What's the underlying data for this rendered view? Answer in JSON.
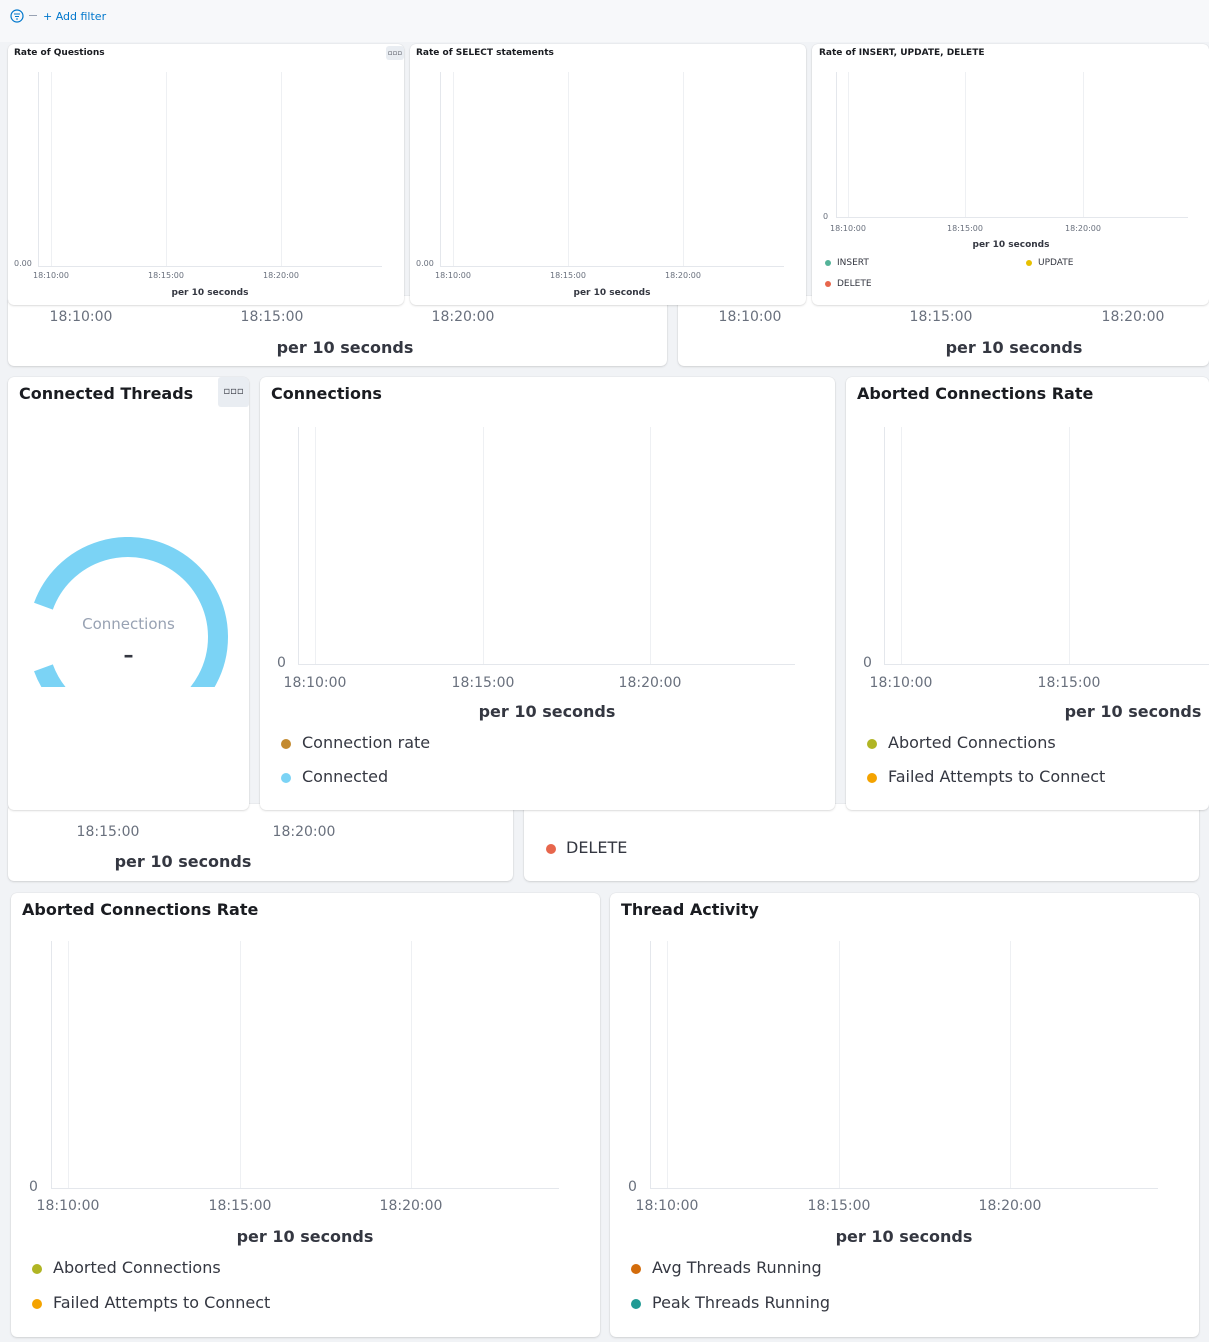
{
  "filter_bar": {
    "add_filter": "+ Add filter"
  },
  "colors": {
    "teal": "#54b399",
    "yellow": "#e7c000",
    "red": "#e7664c",
    "olive": "#b0b524",
    "orange": "#f4a300",
    "brown": "#c38a2f",
    "lightblue": "#7bd3f5",
    "darkorange": "#d36c0b",
    "darkteal": "#209a94"
  },
  "common": {
    "per10": "per 10 seconds"
  },
  "panels": {
    "questions": {
      "title": "Rate of Questions",
      "y0": "0.00",
      "ticks": [
        "18:10:00",
        "18:15:00",
        "18:20:00"
      ]
    },
    "select": {
      "title": "Rate of SELECT statements",
      "y0": "0.00",
      "ticks": [
        "18:10:00",
        "18:15:00",
        "18:20:00"
      ]
    },
    "iud": {
      "title": "Rate of INSERT, UPDATE, DELETE",
      "y0": "0",
      "ticks": [
        "18:10:00",
        "18:15:00",
        "18:20:00"
      ],
      "legend": [
        "INSERT",
        "UPDATE",
        "DELETE"
      ]
    },
    "behind_left": {
      "ticks": [
        "18:10:00",
        "18:15:00",
        "18:20:00"
      ]
    },
    "behind_right": {
      "ticks": [
        "18:10:00",
        "18:15:00",
        "18:20:00"
      ]
    },
    "threads": {
      "title": "Connected Threads",
      "gauge_label": "Connections",
      "gauge_value": "–",
      "gauge_fraction": 1.0
    },
    "connections": {
      "title": "Connections",
      "y0": "0",
      "ticks": [
        "18:10:00",
        "18:15:00",
        "18:20:00"
      ],
      "legend": [
        "Connection rate",
        "Connected"
      ]
    },
    "aborted_top": {
      "title": "Aborted Connections Rate",
      "y0": "0",
      "ticks": [
        "18:10:00",
        "18:15:00"
      ],
      "legend": [
        "Aborted Connections",
        "Failed Attempts to Connect"
      ]
    },
    "behind2_left": {
      "ticks": [
        "18:15:00",
        "18:20:00"
      ]
    },
    "behind2_right": {
      "legend": [
        "DELETE"
      ]
    },
    "aborted_bottom": {
      "title": "Aborted Connections Rate",
      "y0": "0",
      "ticks": [
        "18:10:00",
        "18:15:00",
        "18:20:00"
      ],
      "legend": [
        "Aborted Connections",
        "Failed Attempts to Connect"
      ]
    },
    "thread_activity": {
      "title": "Thread Activity",
      "y0": "0",
      "ticks": [
        "18:10:00",
        "18:15:00",
        "18:20:00"
      ],
      "legend": [
        "Avg Threads Running",
        "Peak Threads Running"
      ]
    }
  }
}
